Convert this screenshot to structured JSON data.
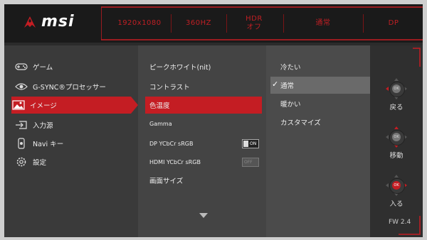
{
  "header": {
    "brand": "msi",
    "status": [
      "1920x1080",
      "360HZ",
      "HDR",
      "オフ",
      "通常",
      "DP"
    ]
  },
  "menu": {
    "items": [
      {
        "label": "ゲーム",
        "icon": "gamepad-icon"
      },
      {
        "label": "G-SYNC®プロセッサー",
        "icon": "gsync-icon"
      },
      {
        "label": "イメージ",
        "icon": "image-icon"
      },
      {
        "label": "入力源",
        "icon": "input-source-icon"
      },
      {
        "label": "Navi キー",
        "icon": "navi-key-icon"
      },
      {
        "label": "設定",
        "icon": "gear-icon"
      }
    ]
  },
  "submenu": {
    "items": [
      {
        "label": "ピークホワイト(nit)"
      },
      {
        "label": "コントラスト"
      },
      {
        "label": "色温度"
      },
      {
        "label": "Gamma"
      },
      {
        "label": "DP YCbCr sRGB",
        "toggle": "ON"
      },
      {
        "label": "HDMI YCbCr sRGB",
        "toggle": "OFF"
      },
      {
        "label": "画面サイズ"
      }
    ]
  },
  "options": {
    "items": [
      "冷たい",
      "通常",
      "暖かい",
      "カスタマイズ"
    ],
    "selected": "通常"
  },
  "nav": {
    "back": "戻る",
    "move": "移動",
    "enter": "入る",
    "ok": "OK"
  },
  "firmware": "FW  2.4",
  "colors": {
    "accent": "#c41d23"
  }
}
